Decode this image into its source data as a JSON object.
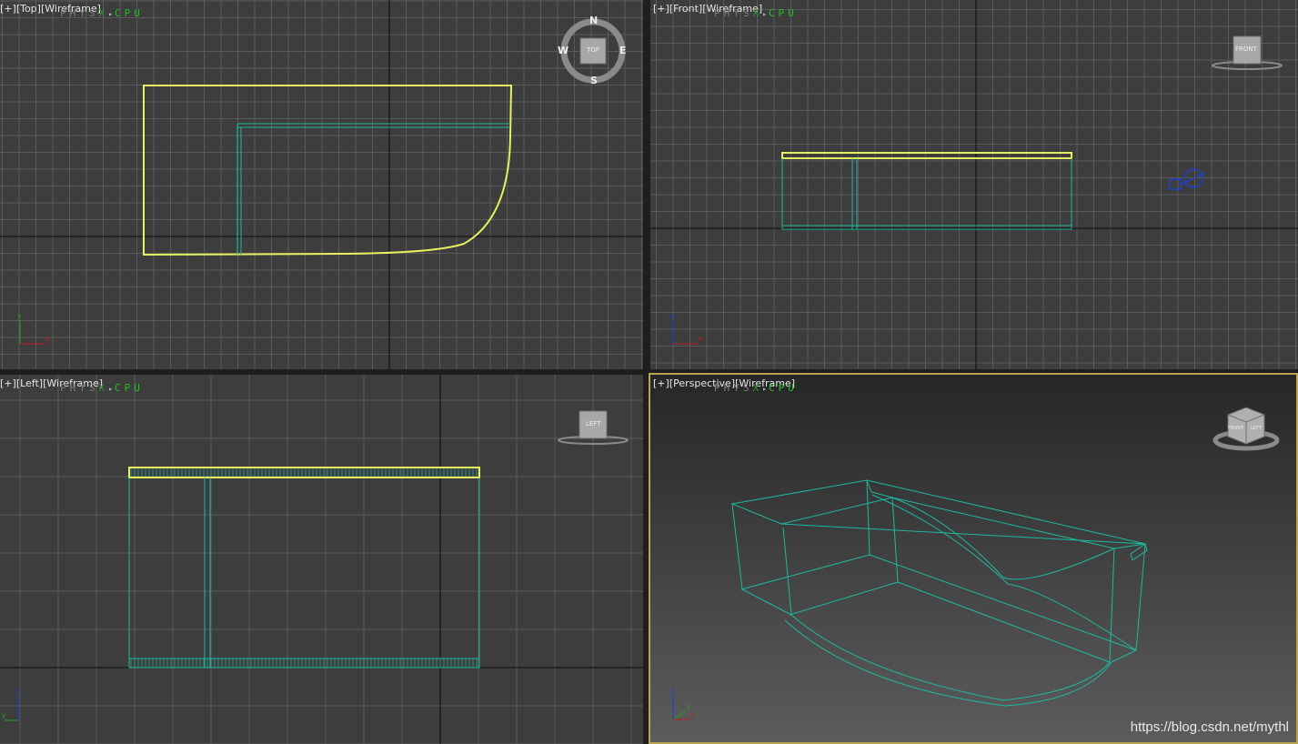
{
  "viewports": {
    "top": {
      "label_plus": "[+]",
      "label_view": "[Top]",
      "label_mode": "[Wireframe]"
    },
    "front": {
      "label_plus": "[+]",
      "label_view": "[Front]",
      "label_mode": "[Wireframe]"
    },
    "left": {
      "label_plus": "[+]",
      "label_view": "[Left]",
      "label_mode": "[Wireframe]"
    },
    "perspective": {
      "label_plus": "[+]",
      "label_view": "[Perspective]",
      "label_mode": "[Wireframe]",
      "active": true
    }
  },
  "physx_overlay": {
    "brand": "PHYS",
    "x": "X",
    "sep": "▸",
    "device": "CPU"
  },
  "viewcube": {
    "top": {
      "face": "TOP",
      "n": "N",
      "s": "S",
      "e": "E",
      "w": "W"
    },
    "front": {
      "face": "FRONT"
    },
    "left": {
      "face": "LEFT"
    },
    "perspective": {
      "face_a": "FRONT",
      "face_b": "LEFT"
    }
  },
  "axis_labels": {
    "top": [
      "x",
      "y"
    ],
    "front": [
      "x",
      "z"
    ],
    "left": [
      "y",
      "z"
    ],
    "perspective": [
      "x",
      "y",
      "z"
    ]
  },
  "watermark": "https://blog.csdn.net/mythl",
  "colors": {
    "viewport_bg": "#3d3d3d",
    "grid_line": "#5a5a5a",
    "grid_axis": "#0a0a0a",
    "selected_outline": "#e8f060",
    "object_wire": "#1fb8a0",
    "active_border": "#b9a451",
    "physx_green": "#22c022"
  }
}
